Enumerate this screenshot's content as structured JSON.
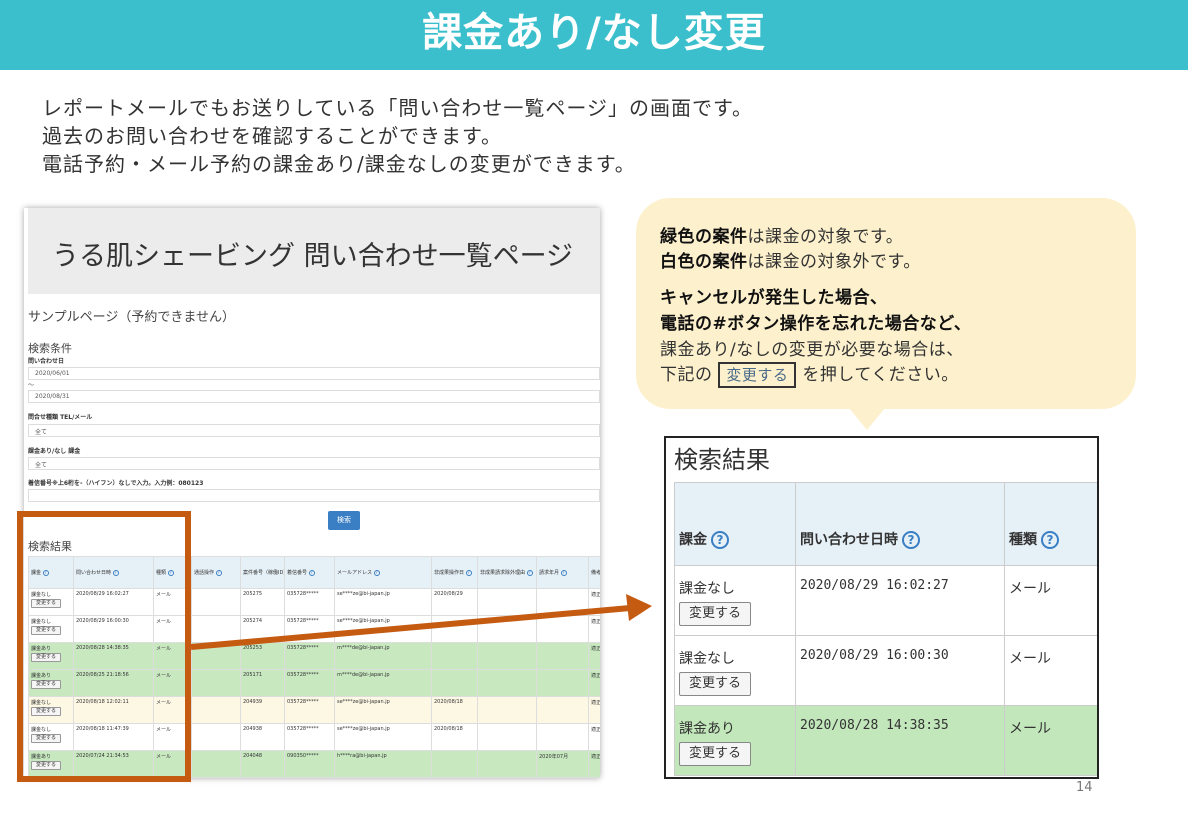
{
  "slide": {
    "title": "課金あり/なし変更",
    "intro": [
      "レポートメールでもお送りしている「問い合わせ一覧ページ」の画面です。",
      "過去のお問い合わせを確認することができます。",
      "電話予約・メール予約の課金あり/課金なしの変更ができます。"
    ],
    "page_number": "14"
  },
  "screenshot": {
    "page_title": "うる肌シェービング 問い合わせ一覧ページ",
    "sample_notice": "サンプルページ（予約できません）",
    "conditions_heading": "検索条件",
    "date_label": "問い合わせ日",
    "date_from": "2020/06/01",
    "date_tilde": "～",
    "date_to": "2020/08/31",
    "type_label": "問合せ種類 TEL/メール",
    "type_value": "全て",
    "billing_label": "課金あり/なし 課金",
    "billing_value": "全て",
    "phone_label": "着信番号※上6桁を-（ハイフン）なしで入力。入力例：080123",
    "search_button": "検索",
    "results_heading": "検索結果",
    "columns": [
      "課金",
      "問い合わせ日時",
      "種類",
      "通話操作",
      "案件番号（稼働ID）",
      "着信番号",
      "メールアドレス",
      "非成果操作日",
      "非成果請求除外理由",
      "請求年月",
      "備考"
    ],
    "change_button": "変更する",
    "rows": [
      {
        "billing": "課金なし",
        "datetime": "2020/08/29 16:02:27",
        "kind": "メール",
        "id": "205275",
        "tel": "035728*****",
        "mail": "se****ze@bi-japan.jp",
        "ng_date": "2020/08/29",
        "month": "",
        "note": "適正",
        "color": "white"
      },
      {
        "billing": "課金なし",
        "datetime": "2020/08/29 16:00:30",
        "kind": "メール",
        "id": "205274",
        "tel": "035728*****",
        "mail": "se****ze@bi-japan.jp",
        "ng_date": "",
        "month": "",
        "note": "適正",
        "color": "white"
      },
      {
        "billing": "課金あり",
        "datetime": "2020/08/28 14:38:35",
        "kind": "メール",
        "id": "205253",
        "tel": "035728*****",
        "mail": "m****de@bi-japan.jp",
        "ng_date": "",
        "month": "",
        "note": "適正",
        "color": "green"
      },
      {
        "billing": "課金あり",
        "datetime": "2020/08/25 21:18:56",
        "kind": "メール",
        "id": "205171",
        "tel": "035728*****",
        "mail": "m****de@bi-japan.jp",
        "ng_date": "",
        "month": "",
        "note": "適正",
        "color": "green"
      },
      {
        "billing": "課金なし",
        "datetime": "2020/08/18 12:02:11",
        "kind": "メール",
        "id": "204939",
        "tel": "035728*****",
        "mail": "se****ze@bi-japan.jp",
        "ng_date": "2020/08/18",
        "month": "",
        "note": "適正",
        "color": "yellow"
      },
      {
        "billing": "課金なし",
        "datetime": "2020/08/18 11:47:39",
        "kind": "メール",
        "id": "204938",
        "tel": "035728*****",
        "mail": "se****ze@bi-japan.jp",
        "ng_date": "2020/08/18",
        "month": "",
        "note": "適正",
        "color": "white"
      },
      {
        "billing": "課金あり",
        "datetime": "2020/07/24 21:34:53",
        "kind": "メール",
        "id": "204048",
        "tel": "090350*****",
        "mail": "h****ra@bi-japan.jp",
        "ng_date": "",
        "month": "2020年07月",
        "note": "適正",
        "color": "green"
      }
    ]
  },
  "callout": {
    "line1_bold": "緑色の案件",
    "line1_rest": "は課金の対象です。",
    "line2_bold": "白色の案件",
    "line2_rest": "は課金の対象外です。",
    "line3": "キャンセルが発生した場合、",
    "line4": "電話の#ボタン操作を忘れた場合など、",
    "line5": "課金あり/なしの変更が必要な場合は、",
    "line6_pre": "下記の",
    "line6_button": "変更する",
    "line6_post": "を押してください。"
  },
  "zoom": {
    "title": "検索結果",
    "col_billing": "課金",
    "col_datetime": "問い合わせ日時",
    "col_kind": "種類",
    "help_icon": "?",
    "change_button": "変更する",
    "rows": [
      {
        "billing": "課金なし",
        "datetime": "2020/08/29 16:02:27",
        "kind": "メール"
      },
      {
        "billing": "課金なし",
        "datetime": "2020/08/29 16:00:30",
        "kind": "メール"
      },
      {
        "billing": "課金あり",
        "datetime": "2020/08/28 14:38:35",
        "kind": "メール"
      }
    ]
  },
  "colors": {
    "header": "#3bbfcc",
    "highlight": "#c55a11",
    "callout": "#fdf1cd",
    "billed_row": "#c2e7bb"
  }
}
